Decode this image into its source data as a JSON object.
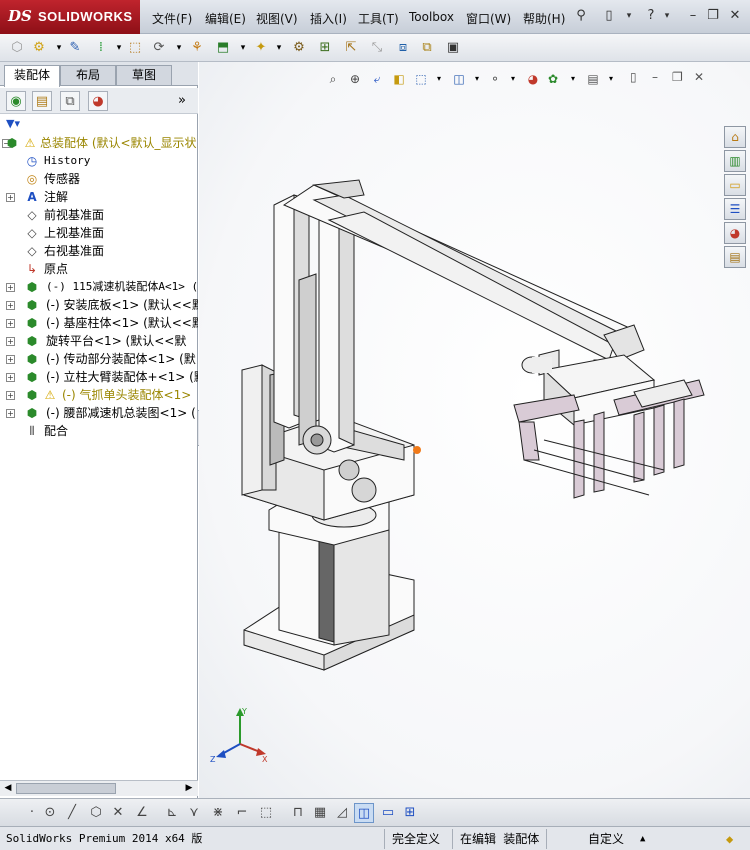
{
  "app": {
    "brand": "SOLIDWORKS",
    "brand_prefix": "DS"
  },
  "menu": [
    "文件(F)",
    "编辑(E)",
    "视图(V)",
    "插入(I)",
    "工具(T)",
    "Toolbox",
    "窗口(W)",
    "帮助(H)"
  ],
  "tabs": [
    "装配体",
    "布局",
    "草图"
  ],
  "tree": {
    "root": "总装配体  (默认<默认_显示状",
    "items": [
      "History",
      "传感器",
      "注解",
      "前视基准面",
      "上视基准面",
      "右视基准面",
      "原点",
      "(-) 115减速机装配体A<1> (",
      "(-) 安装底板<1> (默认<<默认",
      "(-) 基座柱体<1> (默认<<默",
      "旋转平台<1> (默认<<默",
      "(-) 传动部分装配体<1> (默",
      "(-) 立柱大臂装配体+<1> (默",
      "(-) 气抓单头装配体<1>",
      "(-) 腰部减速机总装图<1> (",
      "配合"
    ]
  },
  "status": {
    "product": "SolidWorks Premium 2014 x64 版",
    "state": "完全定义",
    "mode": "在编辑 装配体",
    "custom": "自定义"
  },
  "colors": {
    "warning": "#9a8600",
    "brand": "#b01822",
    "accent_orange": "#f07a1a"
  }
}
